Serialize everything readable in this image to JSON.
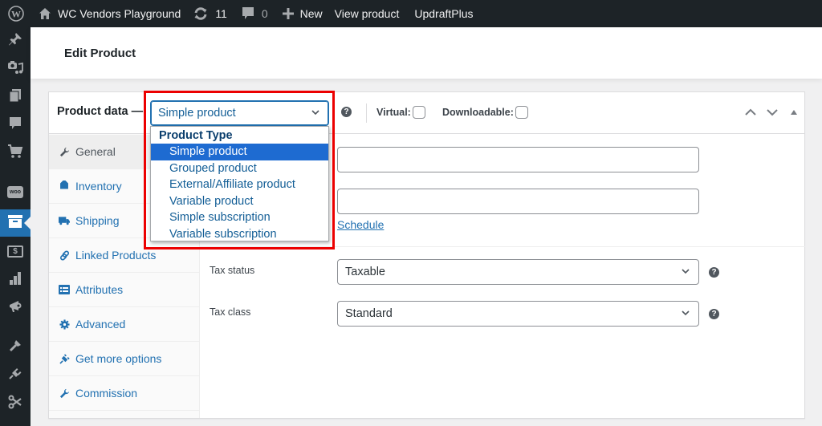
{
  "admin_bar": {
    "wp_logo_icon": "wordpress-logo-icon",
    "site_name": "WC Vendors Playground",
    "updates_count": "11",
    "comments_count": "0",
    "new_label": "New",
    "view_product_label": "View product",
    "updraftplus_label": "UpdraftPlus"
  },
  "admin_menu": {
    "items": [
      {
        "name": "posts",
        "icon": "pushpin-icon"
      },
      {
        "name": "media",
        "icon": "media-icon"
      },
      {
        "name": "pages",
        "icon": "pages-icon"
      },
      {
        "name": "comments",
        "icon": "comment-icon"
      },
      {
        "name": "shop",
        "icon": "cart-icon"
      },
      {
        "name": "woocommerce",
        "icon": "woo-icon",
        "label": "woo"
      },
      {
        "name": "products",
        "icon": "archive-icon",
        "current": true
      },
      {
        "name": "payments",
        "icon": "dollar-icon",
        "label": "$"
      },
      {
        "name": "analytics",
        "icon": "bar-chart-icon"
      },
      {
        "name": "marketing",
        "icon": "megaphone-icon"
      },
      {
        "name": "appearance",
        "icon": "paintbrush-icon"
      },
      {
        "name": "plugins",
        "icon": "plugin-icon"
      },
      {
        "name": "tools",
        "icon": "scissors-icon"
      }
    ]
  },
  "page": {
    "title": "Edit Product"
  },
  "product_data": {
    "title": "Product data —",
    "type_select": {
      "value": "Simple product",
      "dropdown": {
        "group_label": "Product Type",
        "options": [
          {
            "label": "Simple product",
            "selected": true
          },
          {
            "label": "Grouped product",
            "selected": false
          },
          {
            "label": "External/Affiliate product",
            "selected": false
          },
          {
            "label": "Variable product",
            "selected": false
          },
          {
            "label": "Simple subscription",
            "selected": false
          },
          {
            "label": "Variable subscription",
            "selected": false
          }
        ]
      }
    },
    "virtual_label": "Virtual:",
    "virtual_checked": false,
    "downloadable_label": "Downloadable:",
    "downloadable_checked": false,
    "tabs": [
      {
        "label": "General",
        "icon": "wrench-icon",
        "active": true
      },
      {
        "label": "Inventory",
        "icon": "tag-icon",
        "active": false
      },
      {
        "label": "Shipping",
        "icon": "truck-icon",
        "active": false
      },
      {
        "label": "Linked Products",
        "icon": "link-icon",
        "active": false
      },
      {
        "label": "Attributes",
        "icon": "list-card-icon",
        "active": false
      },
      {
        "label": "Advanced",
        "icon": "gear-icon",
        "active": false
      },
      {
        "label": "Get more options",
        "icon": "plugin-icon",
        "active": false
      },
      {
        "label": "Commission",
        "icon": "wrench-icon",
        "active": false
      }
    ],
    "general": {
      "regular_price_value": "",
      "sale_price_value": "",
      "schedule_link": "Schedule",
      "tax_status_label": "Tax status",
      "tax_status_value": "Taxable",
      "tax_class_label": "Tax class",
      "tax_class_value": "Standard"
    }
  },
  "colors": {
    "accent": "#2271b1",
    "admin_bar_bg": "#1d2327",
    "highlight_box": "#ec0000",
    "selected_option_bg": "#1e6bd1"
  }
}
